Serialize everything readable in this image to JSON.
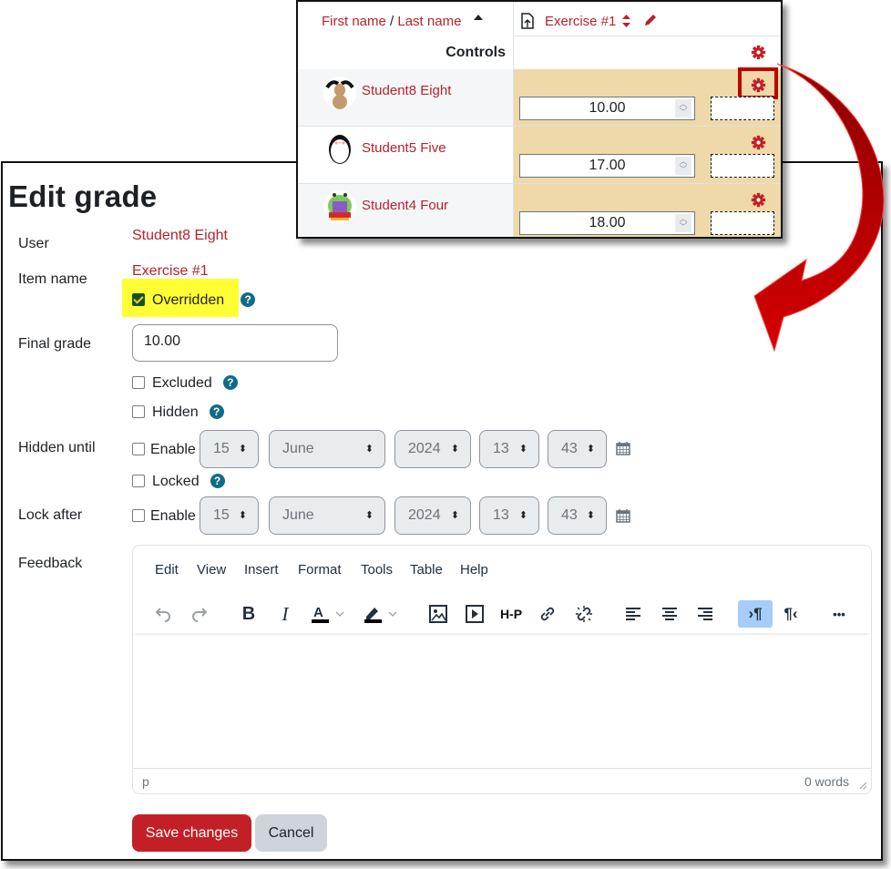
{
  "grader": {
    "header": {
      "name_sort_first": "First name",
      "name_sep": " / ",
      "name_sort_last": "Last name",
      "item_name": "Exercise #1"
    },
    "controls_label": "Controls",
    "rows": [
      {
        "name": "Student8 Eight",
        "grade": "10.00",
        "avatar": "dog",
        "highlighted_gear": true
      },
      {
        "name": "Student5 Five",
        "grade": "17.00",
        "avatar": "penguin",
        "highlighted_gear": false
      },
      {
        "name": "Student4 Four",
        "grade": "18.00",
        "avatar": "bug",
        "highlighted_gear": false
      }
    ]
  },
  "form": {
    "title": "Edit grade",
    "user_label": "User",
    "user_value": "Student8 Eight",
    "item_label": "Item name",
    "item_value": "Exercise #1",
    "overridden_label": "Overridden",
    "overridden_checked": true,
    "final_grade_label": "Final grade",
    "final_grade_value": "10.00",
    "excluded_label": "Excluded",
    "hidden_label": "Hidden",
    "hidden_until_label": "Hidden until",
    "enable_label": "Enable",
    "locked_label": "Locked",
    "lock_after_label": "Lock after",
    "date": {
      "day": "15",
      "month": "June",
      "year": "2024",
      "hour": "13",
      "minute": "43"
    },
    "feedback_label": "Feedback",
    "help_glyph": "?"
  },
  "editor": {
    "menu": [
      "Edit",
      "View",
      "Insert",
      "Format",
      "Tools",
      "Table",
      "Help"
    ],
    "status_path": "p",
    "word_count": "0 words",
    "h5p_label": "H-P",
    "more_glyph": "•••",
    "colors": {
      "active_button": "#a6ccf7"
    }
  },
  "buttons": {
    "save": "Save changes",
    "cancel": "Cancel"
  },
  "colors": {
    "brand_red": "#b7222c",
    "grade_cell": "#efd9a9",
    "arrow": "#c00000",
    "highlight": "#ffff33"
  }
}
